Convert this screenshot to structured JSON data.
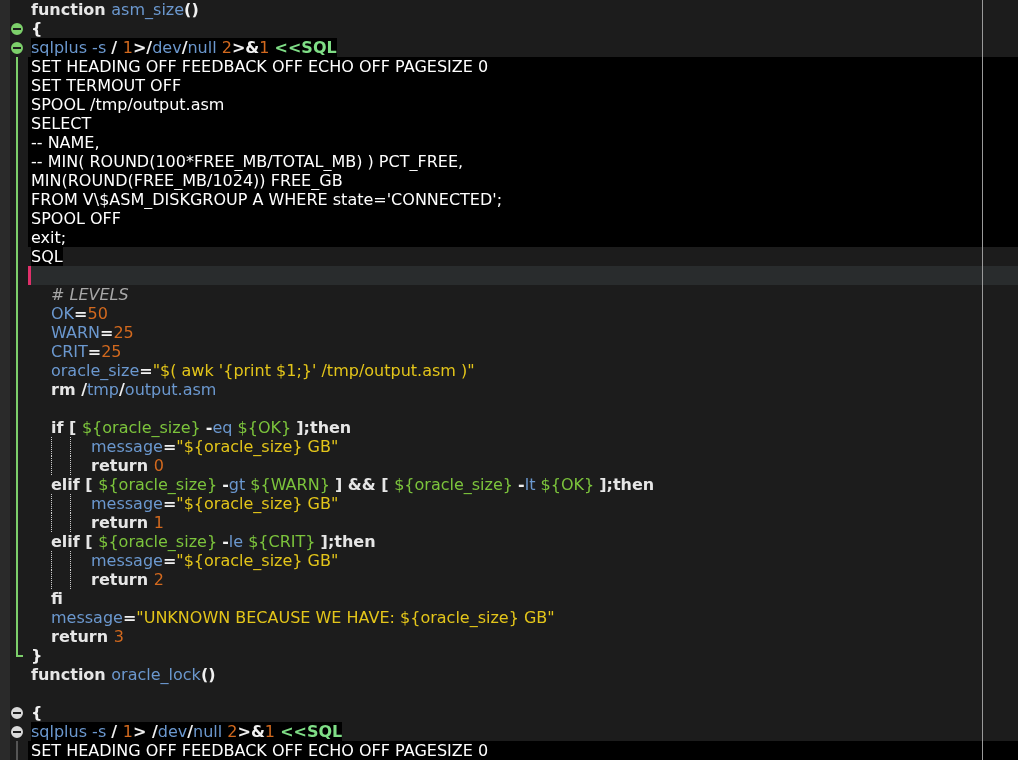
{
  "editor": {
    "lines": [
      {
        "kind": "top",
        "tokens": [
          {
            "kind": "keyword",
            "text": "function "
          },
          {
            "kind": "name",
            "text": "asm_size"
          },
          {
            "kind": "op",
            "text": "()"
          }
        ]
      },
      {
        "kind": "top",
        "fold": true,
        "color": "#7ccf6a",
        "tokens": [
          {
            "kind": "op",
            "text": "{"
          }
        ]
      },
      {
        "kind": "heredoc-edge",
        "fold": true,
        "color": "#7ccf6a",
        "tokens": [
          {
            "kind": "name",
            "text": "sqlplus -s "
          },
          {
            "kind": "op",
            "text": "/ "
          },
          {
            "kind": "number",
            "text": "1"
          },
          {
            "kind": "op",
            "text": ">/"
          },
          {
            "kind": "name",
            "text": "dev"
          },
          {
            "kind": "op",
            "text": "/"
          },
          {
            "kind": "name",
            "text": "null "
          },
          {
            "kind": "number",
            "text": "2"
          },
          {
            "kind": "op",
            "text": ">&"
          },
          {
            "kind": "number",
            "text": "1 "
          },
          {
            "kind": "heredoc",
            "text": "<<SQL"
          }
        ]
      },
      {
        "kind": "heredoc",
        "guide": true,
        "color": "#7ccf6a",
        "tokens": [
          {
            "kind": "sql",
            "text": "SET HEADING OFF FEEDBACK OFF ECHO OFF PAGESIZE 0"
          }
        ]
      },
      {
        "kind": "heredoc",
        "guide": true,
        "color": "#7ccf6a",
        "tokens": [
          {
            "kind": "sql",
            "text": "SET TERMOUT OFF"
          }
        ]
      },
      {
        "kind": "heredoc",
        "guide": true,
        "color": "#7ccf6a",
        "tokens": [
          {
            "kind": "sql",
            "text": "SPOOL /tmp/output.asm"
          }
        ]
      },
      {
        "kind": "heredoc",
        "guide": true,
        "color": "#7ccf6a",
        "tokens": [
          {
            "kind": "sql",
            "text": "SELECT"
          }
        ]
      },
      {
        "kind": "heredoc",
        "guide": true,
        "color": "#7ccf6a",
        "tokens": [
          {
            "kind": "sql",
            "text": "-- NAME,"
          }
        ]
      },
      {
        "kind": "heredoc",
        "guide": true,
        "color": "#7ccf6a",
        "tokens": [
          {
            "kind": "sql",
            "text": "-- MIN( ROUND(100*FREE_MB/TOTAL_MB) ) PCT_FREE,"
          }
        ]
      },
      {
        "kind": "heredoc",
        "guide": true,
        "color": "#7ccf6a",
        "tokens": [
          {
            "kind": "sql",
            "text": "MIN(ROUND(FREE_MB/1024)) FREE_GB"
          }
        ]
      },
      {
        "kind": "heredoc",
        "guide": true,
        "color": "#7ccf6a",
        "tokens": [
          {
            "kind": "sql",
            "text": "FROM V\\$ASM_DISKGROUP A WHERE state='CONNECTED';"
          }
        ]
      },
      {
        "kind": "heredoc",
        "guide": true,
        "color": "#7ccf6a",
        "tokens": [
          {
            "kind": "sql",
            "text": "SPOOL OFF"
          }
        ]
      },
      {
        "kind": "heredoc",
        "guide": true,
        "color": "#7ccf6a",
        "tokens": [
          {
            "kind": "sql",
            "text": "exit;"
          }
        ]
      },
      {
        "kind": "heredoc-edge",
        "guide": true,
        "color": "#7ccf6a",
        "tokens": [
          {
            "kind": "sql",
            "text": "SQL"
          }
        ]
      },
      {
        "kind": "current",
        "guide": true,
        "color": "#7ccf6a"
      },
      {
        "kind": "body",
        "guide": true,
        "color": "#7ccf6a",
        "tokens": [
          {
            "kind": "comment",
            "text": "# LEVELS"
          }
        ]
      },
      {
        "kind": "body",
        "guide": true,
        "color": "#7ccf6a",
        "tokens": [
          {
            "kind": "name",
            "text": "OK"
          },
          {
            "kind": "op",
            "text": "="
          },
          {
            "kind": "number",
            "text": "50"
          }
        ]
      },
      {
        "kind": "body",
        "guide": true,
        "color": "#7ccf6a",
        "tokens": [
          {
            "kind": "name",
            "text": "WARN"
          },
          {
            "kind": "op",
            "text": "="
          },
          {
            "kind": "number",
            "text": "25"
          }
        ]
      },
      {
        "kind": "body",
        "guide": true,
        "color": "#7ccf6a",
        "tokens": [
          {
            "kind": "name",
            "text": "CRIT"
          },
          {
            "kind": "op",
            "text": "="
          },
          {
            "kind": "number",
            "text": "25"
          }
        ]
      },
      {
        "kind": "body",
        "guide": true,
        "color": "#7ccf6a",
        "tokens": [
          {
            "kind": "name",
            "text": "oracle_size"
          },
          {
            "kind": "op",
            "text": "="
          },
          {
            "kind": "string",
            "text": "\"$( awk '{print $1;}' /tmp/output.asm )\""
          }
        ]
      },
      {
        "kind": "body",
        "guide": true,
        "color": "#7ccf6a",
        "tokens": [
          {
            "kind": "keyword",
            "text": "rm "
          },
          {
            "kind": "op",
            "text": "/"
          },
          {
            "kind": "name",
            "text": "tmp"
          },
          {
            "kind": "op",
            "text": "/"
          },
          {
            "kind": "name",
            "text": "output.asm"
          }
        ]
      },
      {
        "kind": "blank",
        "guide": true,
        "color": "#7ccf6a"
      },
      {
        "kind": "body",
        "guide": true,
        "color": "#7ccf6a",
        "tokens": [
          {
            "kind": "keyword",
            "text": "if [ "
          },
          {
            "kind": "variable",
            "text": "${oracle_size} "
          },
          {
            "kind": "op",
            "text": "-"
          },
          {
            "kind": "name",
            "text": "eq "
          },
          {
            "kind": "variable",
            "text": "${OK} "
          },
          {
            "kind": "keyword",
            "text": "];then"
          }
        ]
      },
      {
        "kind": "inner",
        "guide": true,
        "color": "#7ccf6a",
        "tokens": [
          {
            "kind": "name",
            "text": "message"
          },
          {
            "kind": "op",
            "text": "="
          },
          {
            "kind": "string",
            "text": "\"${oracle_size} GB\""
          }
        ]
      },
      {
        "kind": "inner",
        "guide": true,
        "color": "#7ccf6a",
        "tokens": [
          {
            "kind": "keyword",
            "text": "return "
          },
          {
            "kind": "number",
            "text": "0"
          }
        ]
      },
      {
        "kind": "body",
        "guide": true,
        "color": "#7ccf6a",
        "tokens": [
          {
            "kind": "keyword",
            "text": "elif [ "
          },
          {
            "kind": "variable",
            "text": "${oracle_size} "
          },
          {
            "kind": "op",
            "text": "-"
          },
          {
            "kind": "name",
            "text": "gt "
          },
          {
            "kind": "variable",
            "text": "${WARN} "
          },
          {
            "kind": "keyword",
            "text": "] && [ "
          },
          {
            "kind": "variable",
            "text": "${oracle_size} "
          },
          {
            "kind": "op",
            "text": "-"
          },
          {
            "kind": "name",
            "text": "lt "
          },
          {
            "kind": "variable",
            "text": "${OK} "
          },
          {
            "kind": "keyword",
            "text": "];then"
          }
        ]
      },
      {
        "kind": "inner",
        "guide": true,
        "color": "#7ccf6a",
        "tokens": [
          {
            "kind": "name",
            "text": "message"
          },
          {
            "kind": "op",
            "text": "="
          },
          {
            "kind": "string",
            "text": "\"${oracle_size} GB\""
          }
        ]
      },
      {
        "kind": "inner",
        "guide": true,
        "color": "#7ccf6a",
        "tokens": [
          {
            "kind": "keyword",
            "text": "return "
          },
          {
            "kind": "number",
            "text": "1"
          }
        ]
      },
      {
        "kind": "body",
        "guide": true,
        "color": "#7ccf6a",
        "tokens": [
          {
            "kind": "keyword",
            "text": "elif [ "
          },
          {
            "kind": "variable",
            "text": "${oracle_size} "
          },
          {
            "kind": "op",
            "text": "-"
          },
          {
            "kind": "name",
            "text": "le "
          },
          {
            "kind": "variable",
            "text": "${CRIT} "
          },
          {
            "kind": "keyword",
            "text": "];then"
          }
        ]
      },
      {
        "kind": "inner",
        "guide": true,
        "color": "#7ccf6a",
        "tokens": [
          {
            "kind": "name",
            "text": "message"
          },
          {
            "kind": "op",
            "text": "="
          },
          {
            "kind": "string",
            "text": "\"${oracle_size} GB\""
          }
        ]
      },
      {
        "kind": "inner",
        "guide": true,
        "color": "#7ccf6a",
        "tokens": [
          {
            "kind": "keyword",
            "text": "return "
          },
          {
            "kind": "number",
            "text": "2"
          }
        ]
      },
      {
        "kind": "body",
        "guide": true,
        "color": "#7ccf6a",
        "tokens": [
          {
            "kind": "keyword",
            "text": "fi"
          }
        ]
      },
      {
        "kind": "body",
        "guide": true,
        "color": "#7ccf6a",
        "tokens": [
          {
            "kind": "name",
            "text": "message"
          },
          {
            "kind": "op",
            "text": "="
          },
          {
            "kind": "string",
            "text": "\"UNKNOWN BECAUSE WE HAVE: ${oracle_size} GB\""
          }
        ]
      },
      {
        "kind": "body",
        "guide": true,
        "color": "#7ccf6a",
        "tokens": [
          {
            "kind": "keyword",
            "text": "return "
          },
          {
            "kind": "number",
            "text": "3"
          }
        ]
      },
      {
        "kind": "top",
        "guide_end": true,
        "color": "#7ccf6a",
        "tokens": [
          {
            "kind": "op",
            "text": "}"
          }
        ]
      },
      {
        "kind": "top",
        "tokens": [
          {
            "kind": "keyword",
            "text": "function "
          },
          {
            "kind": "name",
            "text": "oracle_lock"
          },
          {
            "kind": "op",
            "text": "()"
          }
        ]
      },
      {
        "kind": "blank"
      },
      {
        "kind": "top",
        "fold": true,
        "color": "#d8d8d8",
        "tokens": [
          {
            "kind": "op",
            "text": "{"
          }
        ]
      },
      {
        "kind": "heredoc-edge",
        "fold": true,
        "color": "#d8d8d8",
        "tokens": [
          {
            "kind": "name",
            "text": "sqlplus -s "
          },
          {
            "kind": "op",
            "text": "/ "
          },
          {
            "kind": "number",
            "text": "1"
          },
          {
            "kind": "op",
            "text": "> /"
          },
          {
            "kind": "name",
            "text": "dev"
          },
          {
            "kind": "op",
            "text": "/"
          },
          {
            "kind": "name",
            "text": "null "
          },
          {
            "kind": "number",
            "text": "2"
          },
          {
            "kind": "op",
            "text": ">&"
          },
          {
            "kind": "number",
            "text": "1 "
          },
          {
            "kind": "heredoc",
            "text": "<<SQL"
          }
        ]
      },
      {
        "kind": "heredoc",
        "guide": true,
        "color": "#555555",
        "tokens": [
          {
            "kind": "sql",
            "text": "SET HEADING OFF FEEDBACK OFF ECHO OFF PAGESIZE 0"
          }
        ]
      }
    ]
  }
}
